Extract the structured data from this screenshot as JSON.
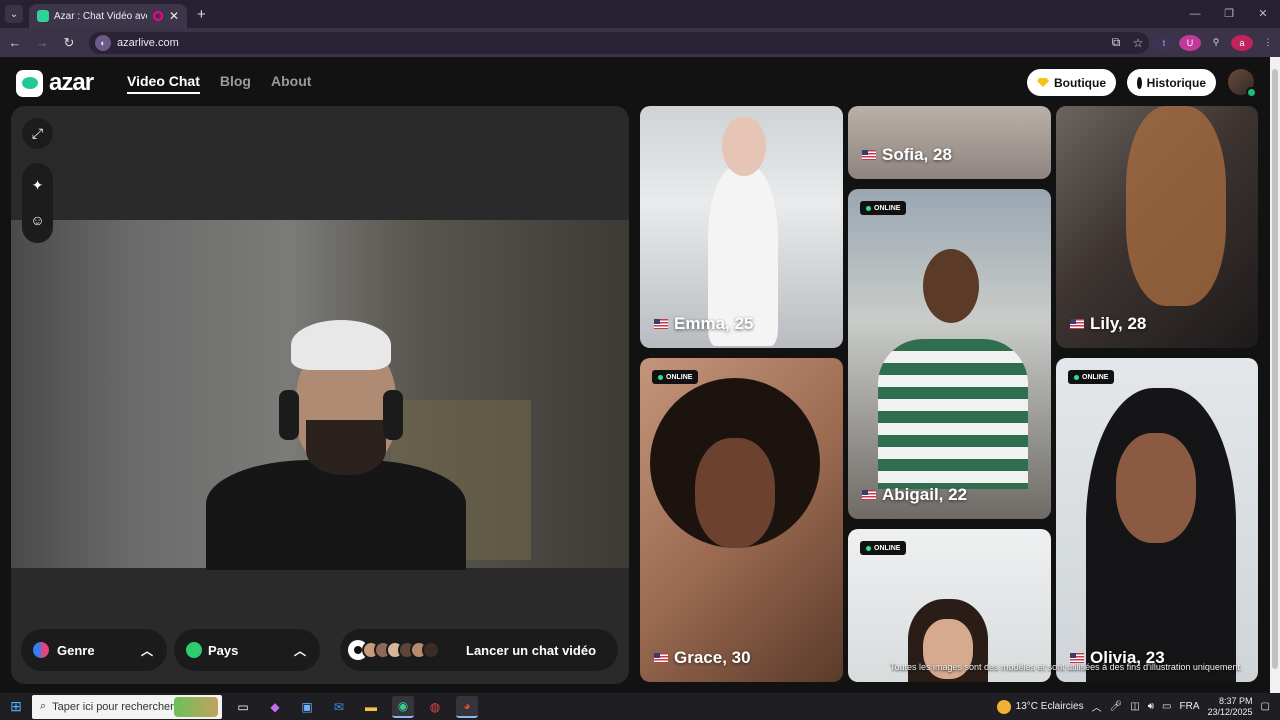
{
  "browser": {
    "tab_title": "Azar : Chat Vidéo avec de n",
    "url": "azarlive.com",
    "close_symbol": "✕",
    "new_tab_symbol": "+"
  },
  "site": {
    "brand": "azar",
    "nav": {
      "video_chat": "Video Chat",
      "blog": "Blog",
      "about": "About"
    },
    "boutique": "Boutique",
    "historique": "Historique"
  },
  "controls": {
    "genre": "Genre",
    "pays": "Pays",
    "start": "Lancer un chat vidéo"
  },
  "profiles": [
    {
      "name": "Emma, 25",
      "online": false
    },
    {
      "name": "Sofia, 28",
      "online": false
    },
    {
      "name": "Lily, 28",
      "online": false
    },
    {
      "name": "Abigail, 22",
      "online": true
    },
    {
      "name": "Grace, 30",
      "online": true
    },
    {
      "name": "Olivia, 23",
      "online": true
    },
    {
      "name": "",
      "online": true
    }
  ],
  "online_label": "ONLINE",
  "disclaimer": "Toutes les images sont des modèles et sont utilisées à des fins d'illustration uniquement.",
  "taskbar": {
    "search_placeholder": "Taper ici pour rechercher",
    "weather": "13°C  Eclaircies",
    "lang": "FRA",
    "time": "8:37 PM",
    "date": "23/12/2025"
  },
  "colors": {
    "accent": "#20c997",
    "online": "#2ee58f",
    "panel": "#2a2a2a"
  }
}
